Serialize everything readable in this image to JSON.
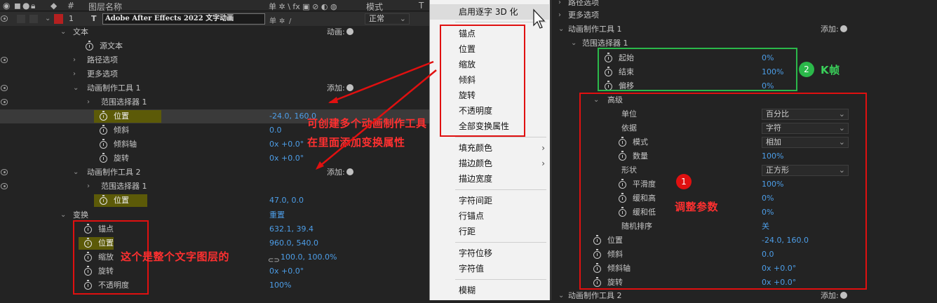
{
  "header": {
    "col_num": "#",
    "col_name": "图层名称",
    "col_switches": "单 ✲ \\ fx ▣ ⊘ ◐ ◍",
    "col_mode": "模式",
    "col_t": "T"
  },
  "layer": {
    "num": "1",
    "type": "T",
    "name": "Adobe After Effects 2022 文字动画",
    "mode": "正常"
  },
  "left_rows": [
    {
      "label": "文本",
      "right": "动画:"
    },
    {
      "label": "源文本"
    },
    {
      "label": "路径选项"
    },
    {
      "label": "更多选项"
    },
    {
      "label": "动画制作工具 1",
      "right": "添加:"
    },
    {
      "label": "范围选择器 1"
    },
    {
      "label": "位置",
      "value": "-24.0, 160.0"
    },
    {
      "label": "倾斜",
      "value": "0.0"
    },
    {
      "label": "倾斜轴",
      "value": "0x +0.0°"
    },
    {
      "label": "旋转",
      "value": "0x +0.0°"
    },
    {
      "label": "动画制作工具 2",
      "right": "添加:"
    },
    {
      "label": "范围选择器 1"
    },
    {
      "label": "位置",
      "value": "47.0, 0.0"
    },
    {
      "label": "变换",
      "value": "重置"
    },
    {
      "label": "锚点",
      "value": "632.1, 39.4"
    },
    {
      "label": "位置",
      "value": "960.0, 540.0"
    },
    {
      "label": "缩放",
      "value": "100.0, 100.0%"
    },
    {
      "label": "旋转",
      "value": "0x +0.0°"
    },
    {
      "label": "不透明度",
      "value": "100%"
    }
  ],
  "menu": {
    "items": [
      "启用逐字 3D 化",
      "锚点",
      "位置",
      "缩放",
      "倾斜",
      "旋转",
      "不透明度",
      "全部变换属性",
      "填充颜色",
      "描边颜色",
      "描边宽度",
      "字符间距",
      "行锚点",
      "行距",
      "字符位移",
      "字符值",
      "模糊"
    ]
  },
  "right_rows": [
    {
      "label": "路径选项"
    },
    {
      "label": "更多选项"
    },
    {
      "label": "动画制作工具 1",
      "right": "添加:"
    },
    {
      "label": "范围选择器 1"
    },
    {
      "label": "起始",
      "value": "0%"
    },
    {
      "label": "结束",
      "value": "100%"
    },
    {
      "label": "偏移",
      "value": "0%"
    },
    {
      "label": "高级"
    },
    {
      "label": "单位",
      "value": "百分比"
    },
    {
      "label": "依据",
      "value": "字符"
    },
    {
      "label": "模式",
      "value": "相加"
    },
    {
      "label": "数量",
      "value": "100%"
    },
    {
      "label": "形状",
      "value": "正方形"
    },
    {
      "label": "平滑度",
      "value": "100%"
    },
    {
      "label": "缓和高",
      "value": "0%"
    },
    {
      "label": "缓和低",
      "value": "0%"
    },
    {
      "label": "随机排序",
      "value": "关"
    },
    {
      "label": "位置",
      "value": "-24.0, 160.0"
    },
    {
      "label": "倾斜",
      "value": "0.0"
    },
    {
      "label": "倾斜轴",
      "value": "0x +0.0°"
    },
    {
      "label": "旋转",
      "value": "0x +0.0°"
    },
    {
      "label": "动画制作工具 2",
      "right": "添加:"
    }
  ],
  "annotations": {
    "multi_tools_line1": "可创建多个动画制作工具",
    "multi_tools_line2": "在里面添加变换属性",
    "whole_layer": "这个是整个文字图层的",
    "adjust_params": "调整参数",
    "adjust_num": "1",
    "keyframe": "K帧",
    "keyframe_num": "2"
  },
  "colors": {
    "accent_blue": "#4d9ee8",
    "highlight": "#5c5a08",
    "red_annot": "#e01010",
    "green_annot": "#2bb84a",
    "layer_label": "#b52020"
  }
}
